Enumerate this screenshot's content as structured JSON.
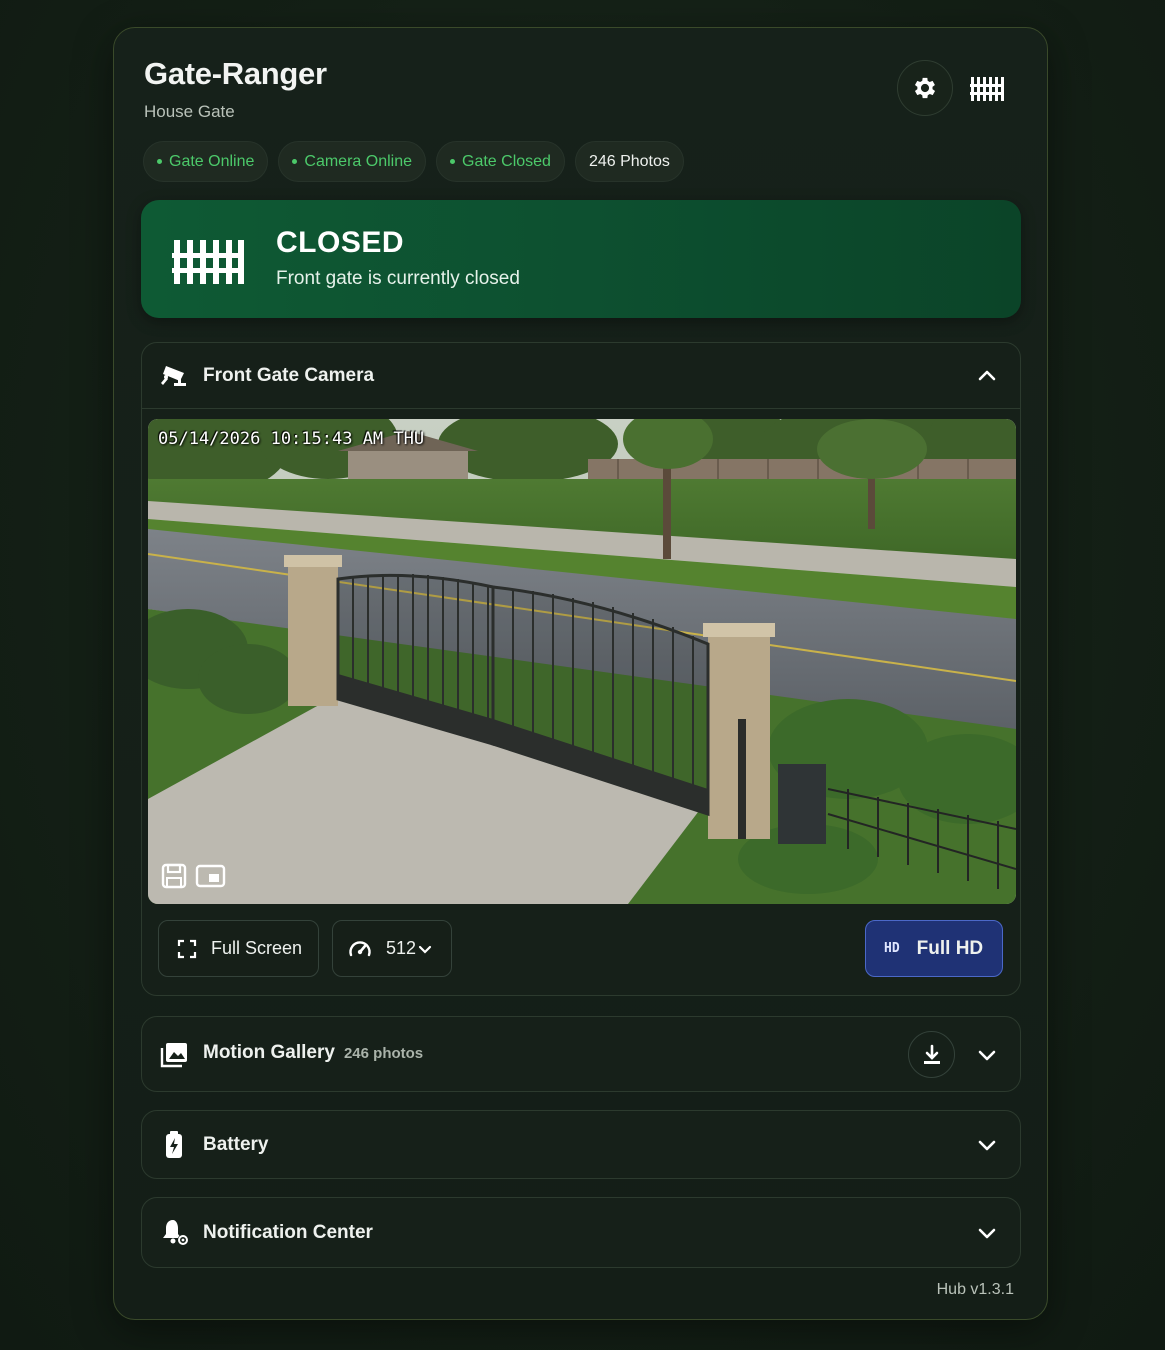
{
  "app": {
    "title": "Gate-Ranger",
    "subtitle": "House Gate",
    "version": "Hub v1.3.1"
  },
  "chips": [
    {
      "label": "Gate Online",
      "status_color": "#4cc96a"
    },
    {
      "label": "Camera Online",
      "status_color": "#4cc96a"
    },
    {
      "label": "Gate Closed",
      "status_color": "#4cc96a"
    },
    {
      "label": "246 Photos"
    }
  ],
  "status": {
    "title": "CLOSED",
    "message": "Front gate is currently closed",
    "color": "#0e5a34"
  },
  "camera": {
    "title": "Front Gate Camera",
    "timestamp": "05/14/2026 10:15:43 AM THU",
    "fullscreen_label": "Full Screen",
    "speed_value": "512",
    "quality_tag": "HD",
    "quality_label": "Full HD",
    "quality_color": "#1f3275"
  },
  "gallery": {
    "title": "Motion Gallery",
    "count": "246 photos"
  },
  "battery": {
    "title": "Battery"
  },
  "notifications": {
    "title": "Notification Center"
  },
  "icons": {
    "settings": "gear-icon",
    "gate": "gate-icon",
    "camera": "security-camera-icon",
    "gallery": "image-gallery-icon",
    "battery": "battery-charging-icon",
    "notifications": "bell-gear-icon",
    "download": "download-icon",
    "fullscreen": "fullscreen-icon",
    "speed": "speedometer-icon"
  }
}
